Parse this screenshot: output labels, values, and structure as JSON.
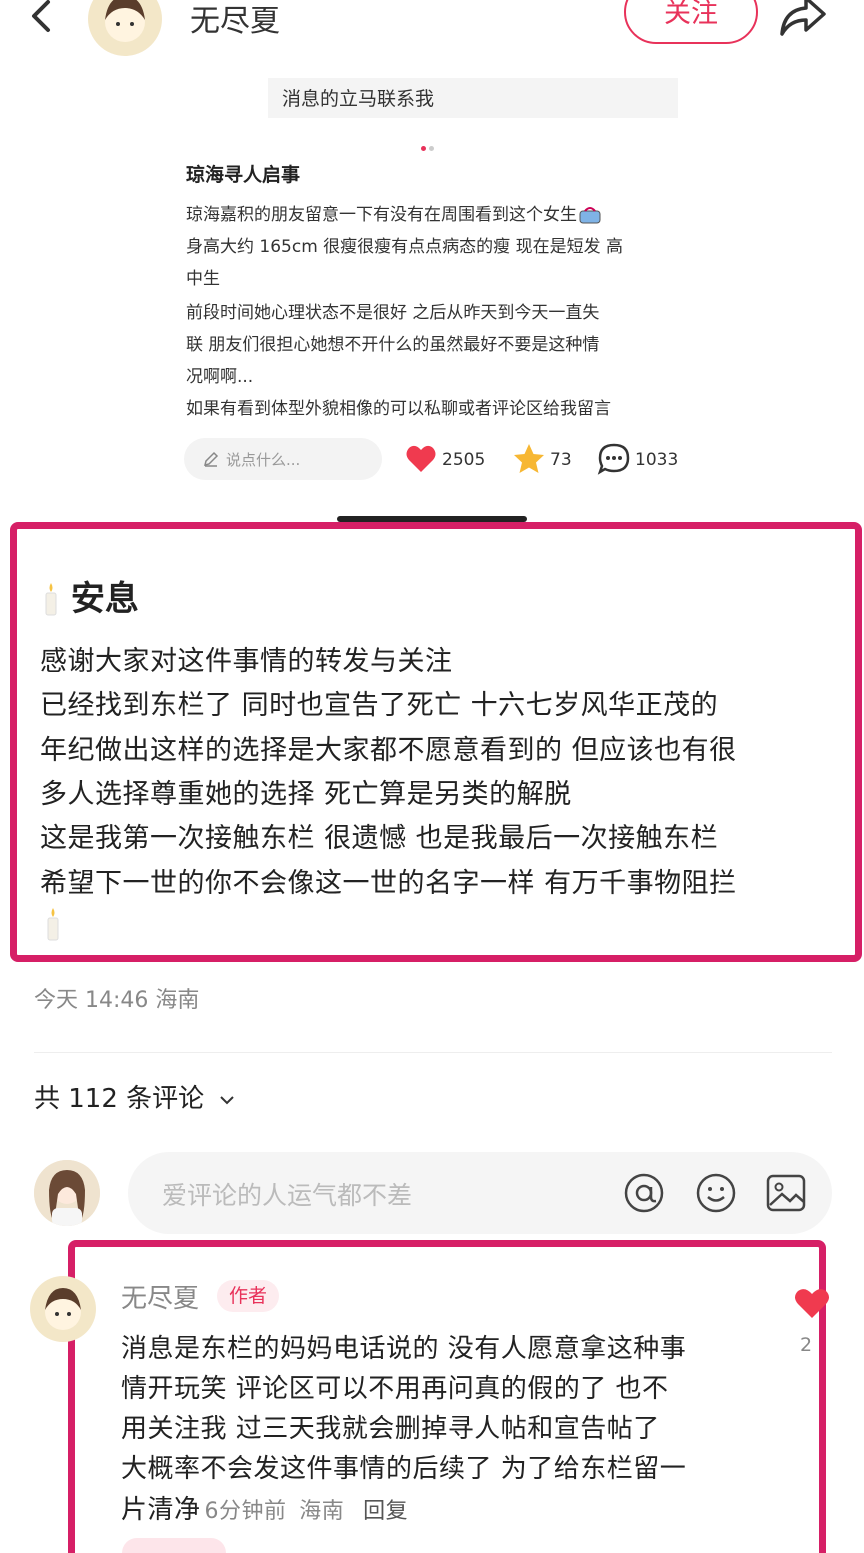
{
  "header": {
    "author_name": "无尽夏",
    "follow_label": "关注"
  },
  "embedded_post": {
    "top_strip": "消息的立马联系我",
    "title": "琼海寻人启事",
    "lines": [
      "琼海嘉积的朋友留意一下有没有在周围看到这个女生",
      "身高大约 165cm 很瘦很瘦有点点病态的瘦 现在是短发 高",
      "中生",
      "前段时间她心理状态不是很好 之后从昨天到今天一直失",
      "联 朋友们很担心她想不开什么的虽然最好不要是这种情",
      "况啊啊...",
      "如果有看到体型外貌相像的可以私聊或者评论区给我留言"
    ],
    "comment_placeholder": "说点什么...",
    "likes": "2505",
    "stars": "73",
    "comments": "1033"
  },
  "main_post": {
    "title": "安息",
    "lines": [
      "感谢大家对这件事情的转发与关注",
      "已经找到东栏了 同时也宣告了死亡 十六七岁风华正茂的",
      "年纪做出这样的选择是大家都不愿意看到的 但应该也有很",
      "多人选择尊重她的选择 死亡算是另类的解脱",
      "这是我第一次接触东栏 很遗憾 也是我最后一次接触东栏",
      "希望下一世的你不会像这一世的名字一样 有万千事物阻拦"
    ],
    "meta": "今天 14:46 海南"
  },
  "comments_section": {
    "count_label": "共 112 条评论",
    "input_placeholder": "爱评论的人运气都不差"
  },
  "author_comment": {
    "name": "无尽夏",
    "tag": "作者",
    "lines": [
      "消息是东栏的妈妈电话说的 没有人愿意拿这种事",
      "情开玩笑 评论区可以不用再问真的假的了 也不",
      "用关注我 过三天我就会删掉寻人帖和宣告帖了",
      "大概率不会发这件事情的后续了 为了给东栏留一",
      "片清净"
    ],
    "time": "6分钟前",
    "location": "海南",
    "reply_label": "回复",
    "like_count": "2"
  },
  "colors": {
    "accent": "#e8325a",
    "highlight_border": "#d61f66"
  },
  "icons": [
    "back-arrow-icon",
    "share-icon",
    "heart-icon",
    "star-icon",
    "comment-bubble-icon",
    "candle-icon",
    "at-icon",
    "emoji-icon",
    "image-icon",
    "pencil-icon",
    "chevron-down-icon"
  ]
}
